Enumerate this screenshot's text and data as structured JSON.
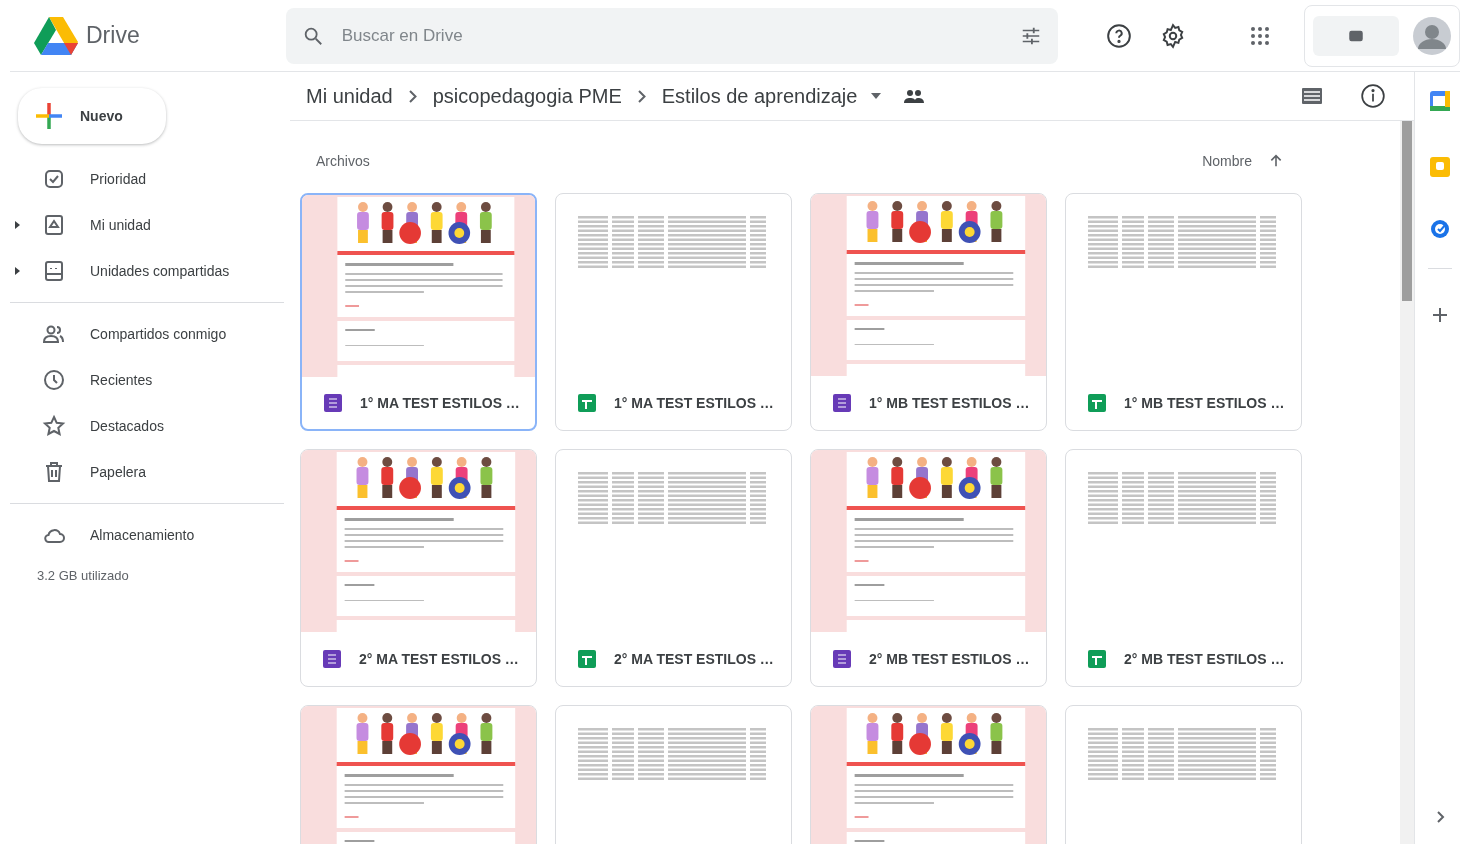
{
  "app": {
    "name": "Drive"
  },
  "search": {
    "placeholder": "Buscar en Drive"
  },
  "new_button": {
    "label": "Nuevo"
  },
  "sidebar": {
    "sections": [
      [
        {
          "label": "Prioridad"
        },
        {
          "label": "Mi unidad",
          "expanded": false
        },
        {
          "label": "Unidades compartidas",
          "expanded": false
        }
      ],
      [
        {
          "label": "Compartidos conmigo"
        },
        {
          "label": "Recientes"
        },
        {
          "label": "Destacados"
        },
        {
          "label": "Papelera"
        }
      ],
      [
        {
          "label": "Almacenamiento"
        }
      ]
    ],
    "storage": "3.2 GB utilizado"
  },
  "breadcrumb": [
    {
      "label": "Mi unidad"
    },
    {
      "label": "psicopedagogia PME"
    },
    {
      "label": "Estilos de aprendizaje"
    }
  ],
  "section_label": "Archivos",
  "sort": {
    "label": "Nombre"
  },
  "files": [
    {
      "kind": "form",
      "name": "1° MA TEST ESTILOS …",
      "selected": true
    },
    {
      "kind": "sheet",
      "name": "1° MA TEST ESTILOS …",
      "selected": false
    },
    {
      "kind": "form",
      "name": "1° MB TEST ESTILOS …",
      "selected": false
    },
    {
      "kind": "sheet",
      "name": "1° MB TEST ESTILOS …",
      "selected": false
    },
    {
      "kind": "form",
      "name": "2° MA TEST ESTILOS …",
      "selected": false
    },
    {
      "kind": "sheet",
      "name": "2° MA TEST ESTILOS …",
      "selected": false
    },
    {
      "kind": "form",
      "name": "2° MB TEST ESTILOS …",
      "selected": false
    },
    {
      "kind": "sheet",
      "name": "2° MB TEST ESTILOS …",
      "selected": false
    },
    {
      "kind": "form",
      "selected": false
    },
    {
      "kind": "sheet",
      "selected": false
    },
    {
      "kind": "form",
      "selected": false
    },
    {
      "kind": "sheet",
      "selected": false
    }
  ]
}
